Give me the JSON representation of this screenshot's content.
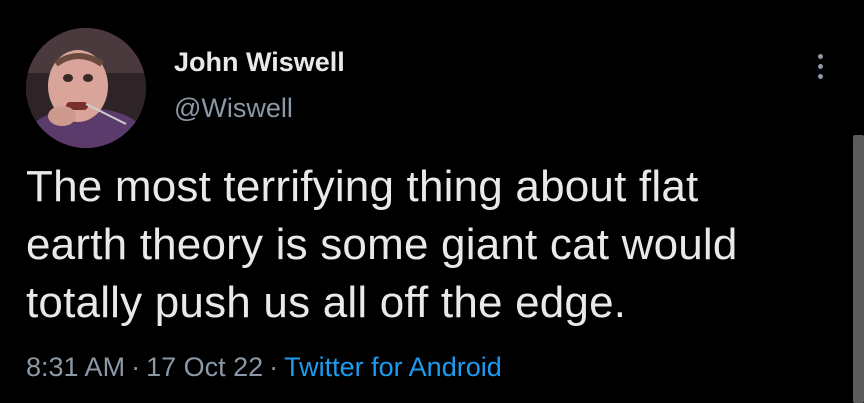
{
  "tweet": {
    "author": {
      "display_name": "John Wiswell",
      "handle": "@Wiswell",
      "avatar": "avatar-photo"
    },
    "more_icon": "more-vertical-icon",
    "text_lines": [
      "The most terrifying thing about flat",
      "earth theory is some giant cat would",
      "totally push us all off the edge."
    ],
    "time": "8:31 AM",
    "date": "17 Oct 22",
    "separator": "·",
    "source": "Twitter for Android"
  },
  "colors": {
    "background": "#000000",
    "text": "#e7e9ea",
    "secondary": "#8b98a5",
    "link": "#1d9bf0"
  }
}
